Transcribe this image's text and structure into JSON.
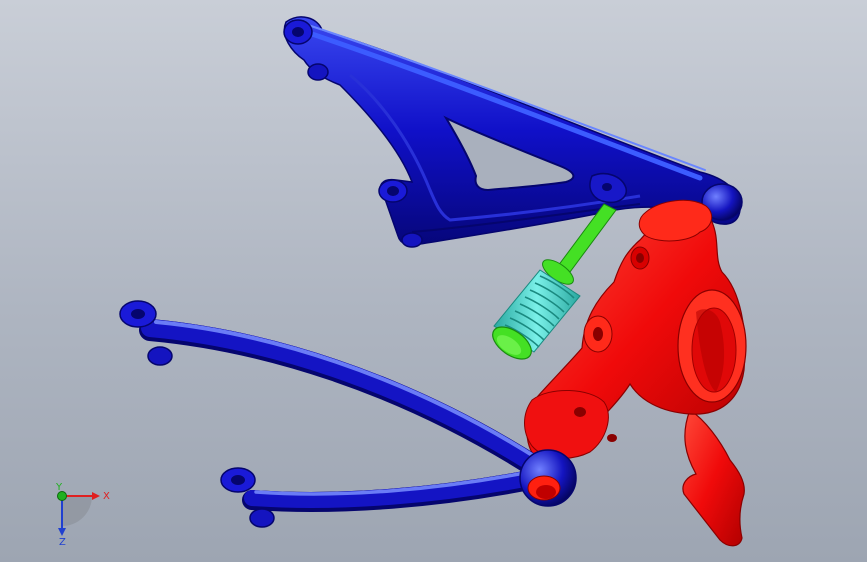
{
  "viewport": {
    "background_top": "#c9ced7",
    "background_bottom": "#9da5b2"
  },
  "colors": {
    "upper_arm": "#1010c8",
    "upper_arm_shadow": "#05056e",
    "lower_arm": "#1212c0",
    "lower_arm_highlight": "#5a6cf0",
    "knuckle": "#ff1010",
    "knuckle_shadow": "#a80000",
    "shock_spring": "#40d8d0",
    "shock_rod": "#40e020"
  },
  "parts": {
    "upper_arm": "upper-control-arm",
    "lower_arm": "lower-control-arm",
    "knuckle": "steering-knuckle",
    "shock": "coilover-shock"
  },
  "triad": {
    "x_label": "X",
    "y_label": "Y",
    "z_label": "Z",
    "x_color": "#e02020",
    "y_color": "#20b020",
    "z_color": "#2040d0"
  }
}
